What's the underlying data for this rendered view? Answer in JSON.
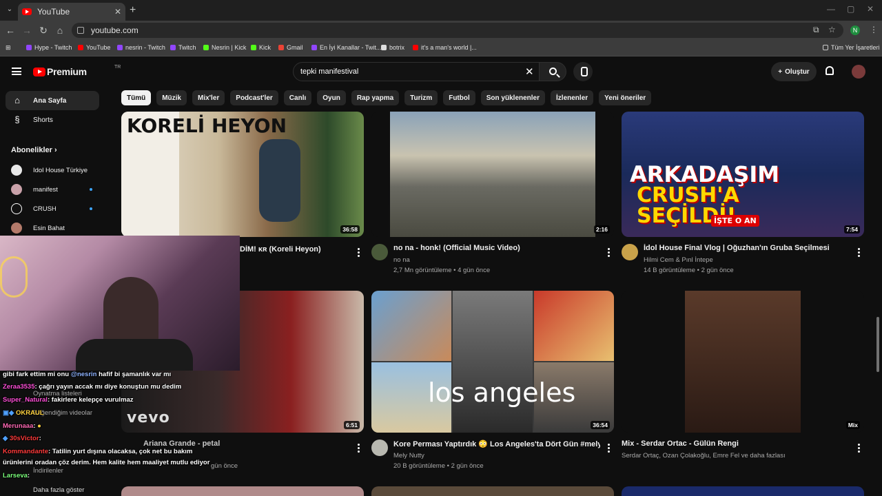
{
  "browser": {
    "tab_title": "YouTube",
    "url": "youtube.com",
    "profile_initial": "N",
    "bookmarks": [
      {
        "label": "Hype - Twitch",
        "color": "#9146ff"
      },
      {
        "label": "YouTube",
        "color": "#ff0000"
      },
      {
        "label": "nesrin - Twitch",
        "color": "#9146ff"
      },
      {
        "label": "Twitch",
        "color": "#9146ff"
      },
      {
        "label": "Nesrin | Kick",
        "color": "#53fc18"
      },
      {
        "label": "Kick",
        "color": "#53fc18"
      },
      {
        "label": "Gmail",
        "color": "#ea4335"
      },
      {
        "label": "En İyi Kanallar - Twit...",
        "color": "#9146ff"
      },
      {
        "label": "botrix",
        "color": "#dddddd"
      },
      {
        "label": "it's a man's world |...",
        "color": "#ff0000"
      }
    ],
    "all_bookmarks": "Tüm Yer İşaretleri"
  },
  "youtube": {
    "brand": "Premium",
    "brand_sup": "TR",
    "search_value": "tepki manifestival",
    "create_label": "Oluştur",
    "sidebar": {
      "home": "Ana Sayfa",
      "shorts": "Shorts",
      "subscriptions_heading": "Abonelikler",
      "subs": [
        {
          "name": "Idol House Türkiye",
          "color": "#e8e8e8"
        },
        {
          "name": "manifest",
          "color": "#c9a1a9"
        },
        {
          "name": "CRUSH",
          "color": "#111111"
        },
        {
          "name": "Esin Bahat",
          "color": "#b37a6a"
        }
      ]
    },
    "chips": [
      "Tümü",
      "Müzik",
      "Mix'ler",
      "Podcast'ler",
      "Canlı",
      "Oyun",
      "Rap yapma",
      "Turizm",
      "Futbol",
      "Son yüklenenler",
      "İzlenenler",
      "Yeni öneriler"
    ],
    "videos": [
      {
        "title": "DİM! ᴋʀ (Koreli Heyon)",
        "channel": "",
        "meta": "",
        "duration": "36:58",
        "thumb_text": "KORELİ HEYON"
      },
      {
        "title": "no na - honk! (Official Music Video)",
        "channel": "no na",
        "meta": "2,7 Mn görüntüleme • 4 gün önce",
        "duration": "2:16"
      },
      {
        "title": "İdol House Final Vlog | Oğuzhan'ın Gruba Seçilmesi",
        "channel": "Hilmi Cem & Pınl İntepe",
        "meta": "14 B görüntüleme • 2 gün önce",
        "duration": "7:54",
        "thumb_text_1": "ARKADAŞIM",
        "thumb_text_2": "CRUSH'A",
        "thumb_text_3": "SEÇİLDİ!",
        "thumb_badge": "İŞTE O AN"
      },
      {
        "title": "Ariana Grande - petal",
        "channel": "",
        "meta": "gün önce",
        "duration": "6:51",
        "thumb_text": "vevo"
      },
      {
        "title": "Kore Perması Yaptırdık 😳 Los Angeles'ta Dört Gün #melyog",
        "channel": "Mely Nutty",
        "meta": "20 B görüntüleme • 2 gün önce",
        "duration": "36:54",
        "thumb_text": "los angeles"
      },
      {
        "title": "Mix - Serdar Ortac - Gülün Rengi",
        "channel": "Serdar Ortaç, Ozan Çolakoğlu, Emre Fel ve daha fazlası",
        "meta": "",
        "duration": "Mix"
      }
    ],
    "hidden_sidebar": [
      "Oynatma listeleri",
      "Beğendiğim videolar",
      "İndirilenler",
      "Daha fazla göster"
    ]
  },
  "chat": [
    {
      "user": "",
      "text": "gibi fark ettim mi onu ",
      "mention": "@nesrin",
      "rest": " hafif bi şamanlık var mı",
      "color": "#ffffff"
    },
    {
      "user": "Zeraa3535",
      "text": ": çağrı yayın accak mı diye konuştun mu dedim",
      "color": "#ff4fd8"
    },
    {
      "user": "Super_Natural",
      "text": ": fakirlere kelepçe vurulmaz",
      "color": "#ff4fd8"
    },
    {
      "user": "OKRAUL",
      "text": "",
      "color": "#ffd23f"
    },
    {
      "user": "Merunaaa",
      "text": ":",
      "color": "#ff69b4"
    },
    {
      "user": "30sVictor",
      "text": ":",
      "color": "#ff3b3b"
    },
    {
      "user": "Kommandante",
      "text": ": Tatilin yurt dışına olacaksa, çok net bu bakım",
      "color": "#ff3b3b"
    },
    {
      "user": "",
      "text": "ürünlerini oradan çöz derim. Hem kalite hem maaliyet mutlu ediyor",
      "color": "#ffffff"
    },
    {
      "user": "Larseva",
      "text": ":",
      "color": "#7cff7c"
    }
  ]
}
